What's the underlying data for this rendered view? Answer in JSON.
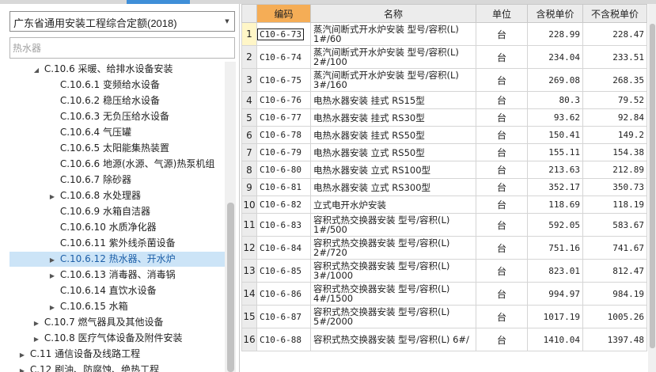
{
  "left_panel": {
    "quota_select": "广东省通用安装工程综合定额(2018)",
    "search_placeholder": "热水器",
    "tree": [
      {
        "label": "C.10.6 采暖、给排水设备安装",
        "level": 1,
        "toggle": "expanded"
      },
      {
        "label": "C.10.6.1 变频给水设备",
        "level": 2,
        "toggle": "none"
      },
      {
        "label": "C.10.6.2 稳压给水设备",
        "level": 2,
        "toggle": "none"
      },
      {
        "label": "C.10.6.3 无负压给水设备",
        "level": 2,
        "toggle": "none"
      },
      {
        "label": "C.10.6.4 气压罐",
        "level": 2,
        "toggle": "none"
      },
      {
        "label": "C.10.6.5 太阳能集热装置",
        "level": 2,
        "toggle": "none"
      },
      {
        "label": "C.10.6.6 地源(水源、气源)热泵机组",
        "level": 2,
        "toggle": "none"
      },
      {
        "label": "C.10.6.7 除砂器",
        "level": 2,
        "toggle": "none"
      },
      {
        "label": "C.10.6.8 水处理器",
        "level": 2,
        "toggle": "collapsed"
      },
      {
        "label": "C.10.6.9 水箱自洁器",
        "level": 2,
        "toggle": "none"
      },
      {
        "label": "C.10.6.10 水质净化器",
        "level": 2,
        "toggle": "none"
      },
      {
        "label": "C.10.6.11 紫外线杀菌设备",
        "level": 2,
        "toggle": "none"
      },
      {
        "label": "C.10.6.12 热水器、开水炉",
        "level": 2,
        "toggle": "collapsed",
        "selected": true
      },
      {
        "label": "C.10.6.13 消毒器、消毒锅",
        "level": 2,
        "toggle": "collapsed"
      },
      {
        "label": "C.10.6.14 直饮水设备",
        "level": 2,
        "toggle": "none"
      },
      {
        "label": "C.10.6.15 水箱",
        "level": 2,
        "toggle": "collapsed"
      },
      {
        "label": "C.10.7 燃气器具及其他设备",
        "level": 1,
        "toggle": "collapsed"
      },
      {
        "label": "C.10.8 医疗气体设备及附件安装",
        "level": 1,
        "toggle": "collapsed"
      },
      {
        "label": "C.11 通信设备及线路工程",
        "level": 0,
        "toggle": "collapsed"
      },
      {
        "label": "C.12 刷油、防腐蚀、绝热工程",
        "level": 0,
        "toggle": "collapsed"
      }
    ]
  },
  "table": {
    "headers": {
      "code": "编码",
      "name": "名称",
      "unit": "单位",
      "price_tax": "含税单价",
      "price_notax": "不含税单价"
    },
    "rows": [
      {
        "idx": "1",
        "code": "C10-6-73",
        "name": "蒸汽间断式开水炉安装 型号/容积(L) 1#/60",
        "unit": "台",
        "price_tax": "228.99",
        "price_notax": "228.47",
        "tall": true
      },
      {
        "idx": "2",
        "code": "C10-6-74",
        "name": "蒸汽间断式开水炉安装 型号/容积(L) 2#/100",
        "unit": "台",
        "price_tax": "234.04",
        "price_notax": "233.51",
        "tall": true
      },
      {
        "idx": "3",
        "code": "C10-6-75",
        "name": "蒸汽间断式开水炉安装 型号/容积(L) 3#/160",
        "unit": "台",
        "price_tax": "269.08",
        "price_notax": "268.35",
        "tall": true
      },
      {
        "idx": "4",
        "code": "C10-6-76",
        "name": "电热水器安装 挂式 RS15型",
        "unit": "台",
        "price_tax": "80.3",
        "price_notax": "79.52",
        "tall": false
      },
      {
        "idx": "5",
        "code": "C10-6-77",
        "name": "电热水器安装 挂式 RS30型",
        "unit": "台",
        "price_tax": "93.62",
        "price_notax": "92.84",
        "tall": false
      },
      {
        "idx": "6",
        "code": "C10-6-78",
        "name": "电热水器安装 挂式 RS50型",
        "unit": "台",
        "price_tax": "150.41",
        "price_notax": "149.2",
        "tall": false
      },
      {
        "idx": "7",
        "code": "C10-6-79",
        "name": "电热水器安装 立式 RS50型",
        "unit": "台",
        "price_tax": "155.11",
        "price_notax": "154.38",
        "tall": false
      },
      {
        "idx": "8",
        "code": "C10-6-80",
        "name": "电热水器安装 立式 RS100型",
        "unit": "台",
        "price_tax": "213.63",
        "price_notax": "212.89",
        "tall": false
      },
      {
        "idx": "9",
        "code": "C10-6-81",
        "name": "电热水器安装 立式 RS300型",
        "unit": "台",
        "price_tax": "352.17",
        "price_notax": "350.73",
        "tall": false
      },
      {
        "idx": "10",
        "code": "C10-6-82",
        "name": "立式电开水炉安装",
        "unit": "台",
        "price_tax": "118.69",
        "price_notax": "118.19",
        "tall": false
      },
      {
        "idx": "11",
        "code": "C10-6-83",
        "name": "容积式热交换器安装 型号/容积(L) 1#/500",
        "unit": "台",
        "price_tax": "592.05",
        "price_notax": "583.67",
        "tall": true
      },
      {
        "idx": "12",
        "code": "C10-6-84",
        "name": "容积式热交换器安装 型号/容积(L) 2#/720",
        "unit": "台",
        "price_tax": "751.16",
        "price_notax": "741.67",
        "tall": true
      },
      {
        "idx": "13",
        "code": "C10-6-85",
        "name": "容积式热交换器安装 型号/容积(L) 3#/1000",
        "unit": "台",
        "price_tax": "823.01",
        "price_notax": "812.47",
        "tall": true
      },
      {
        "idx": "14",
        "code": "C10-6-86",
        "name": "容积式热交换器安装 型号/容积(L) 4#/1500",
        "unit": "台",
        "price_tax": "994.97",
        "price_notax": "984.19",
        "tall": true
      },
      {
        "idx": "15",
        "code": "C10-6-87",
        "name": "容积式热交换器安装 型号/容积(L) 5#/2000",
        "unit": "台",
        "price_tax": "1017.19",
        "price_notax": "1005.26",
        "tall": true
      },
      {
        "idx": "16",
        "code": "C10-6-88",
        "name": "容积式热交换器安装 型号/容积(L) 6#/",
        "unit": "台",
        "price_tax": "1410.04",
        "price_notax": "1397.48",
        "tall": true
      }
    ]
  }
}
